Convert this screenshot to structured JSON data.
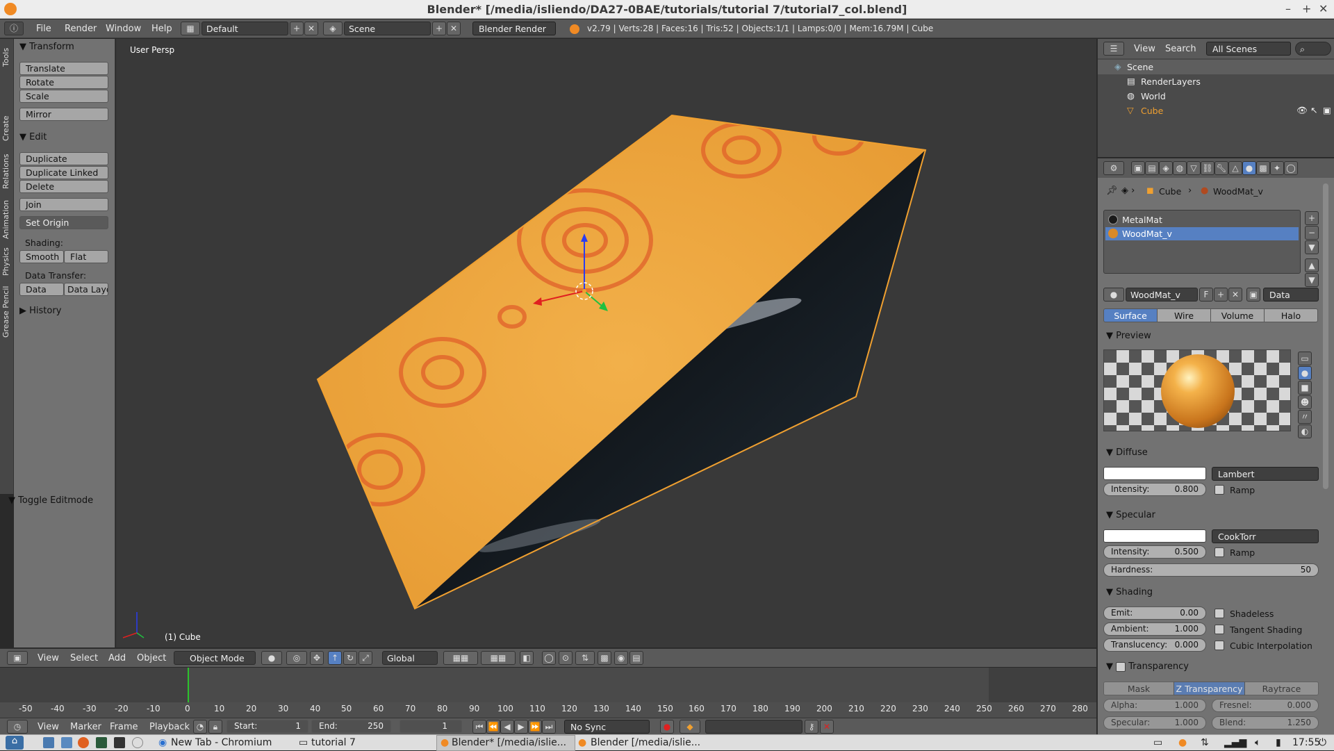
{
  "window": {
    "title": "Blender* [/media/isliendo/DA27-0BAE/tutorials/tutorial 7/tutorial7_col.blend]",
    "controls": [
      "–",
      "+",
      "✕"
    ]
  },
  "infobar": {
    "menus": [
      "File",
      "Render",
      "Window",
      "Help"
    ],
    "layout": "Default",
    "scene": "Scene",
    "engine": "Blender Render",
    "stats": "v2.79 | Verts:28 | Faces:16 | Tris:52 | Objects:1/1 | Lamps:0/0 | Mem:16.79M | Cube"
  },
  "toolshelf": {
    "tabs": [
      "Tools",
      "Create",
      "Relations",
      "Animation",
      "Physics",
      "Grease Pencil"
    ],
    "transform_header": "Transform",
    "translate": "Translate",
    "rotate": "Rotate",
    "scale": "Scale",
    "mirror": "Mirror",
    "edit_header": "Edit",
    "duplicate": "Duplicate",
    "duplicate_linked": "Duplicate Linked",
    "delete": "Delete",
    "join": "Join",
    "set_origin": "Set Origin",
    "shading_label": "Shading:",
    "smooth": "Smooth",
    "flat": "Flat",
    "data_transfer_label": "Data Transfer:",
    "data": "Data",
    "data_layout": "Data Layo",
    "history_header": "History",
    "toggle_editmode": "Toggle Editmode"
  },
  "viewport": {
    "view_label": "User Persp",
    "object_label": "(1) Cube",
    "header": {
      "menus": [
        "View",
        "Select",
        "Add",
        "Object"
      ],
      "mode": "Object Mode",
      "orientation": "Global"
    }
  },
  "timeline": {
    "ticks": [
      "-50",
      "-40",
      "-30",
      "-20",
      "-10",
      "0",
      "10",
      "20",
      "30",
      "40",
      "50",
      "60",
      "70",
      "80",
      "90",
      "100",
      "110",
      "120",
      "130",
      "140",
      "150",
      "160",
      "170",
      "180",
      "190",
      "200",
      "210",
      "220",
      "230",
      "240",
      "250",
      "260",
      "270",
      "280"
    ],
    "menus": [
      "View",
      "Marker",
      "Frame",
      "Playback"
    ],
    "start_label": "Start:",
    "start_value": "1",
    "end_label": "End:",
    "end_value": "250",
    "current_frame": "1",
    "sync": "No Sync"
  },
  "outliner": {
    "menus": [
      "View",
      "Search"
    ],
    "filter": "All Scenes",
    "items": [
      {
        "label": "Scene"
      },
      {
        "label": "RenderLayers"
      },
      {
        "label": "World"
      },
      {
        "label": "Cube"
      }
    ]
  },
  "properties": {
    "breadcrumb_object": "Cube",
    "breadcrumb_material": "WoodMat_v",
    "materials": [
      {
        "name": "MetalMat",
        "color": "#1a1a1a"
      },
      {
        "name": "WoodMat_v",
        "color": "#d98a2a"
      }
    ],
    "material_name": "WoodMat_v",
    "fake_user": "F",
    "link": "Data",
    "tabs": [
      "Surface",
      "Wire",
      "Volume",
      "Halo"
    ],
    "preview_header": "Preview",
    "diffuse": {
      "header": "Diffuse",
      "shader": "Lambert",
      "intensity_label": "Intensity:",
      "intensity": "0.800",
      "ramp": "Ramp"
    },
    "specular": {
      "header": "Specular",
      "shader": "CookTorr",
      "intensity_label": "Intensity:",
      "intensity": "0.500",
      "ramp": "Ramp",
      "hardness_label": "Hardness:",
      "hardness": "50"
    },
    "shading": {
      "header": "Shading",
      "emit_label": "Emit:",
      "emit": "0.00",
      "ambient_label": "Ambient:",
      "ambient": "1.000",
      "translucency_label": "Translucency:",
      "translucency": "0.000",
      "shadeless": "Shadeless",
      "tangent": "Tangent Shading",
      "cubic": "Cubic Interpolation"
    },
    "transparency": {
      "header": "Transparency",
      "modes": [
        "Mask",
        "Z Transparency",
        "Raytrace"
      ],
      "alpha_label": "Alpha:",
      "alpha": "1.000",
      "fresnel_label": "Fresnel:",
      "fresnel": "0.000",
      "specular_label": "Specular:",
      "specular": "1.000",
      "blend_label": "Blend:",
      "blend": "1.250"
    }
  },
  "taskbar": {
    "items": [
      "New Tab - Chromium",
      "tutorial 7",
      "Blender* [/media/islie...",
      "Blender [/media/islie..."
    ],
    "clock": "17:55"
  },
  "colors": {
    "accent": "#5680c2",
    "wood": "#e8a23a",
    "selection_outline": "#f0a030"
  }
}
